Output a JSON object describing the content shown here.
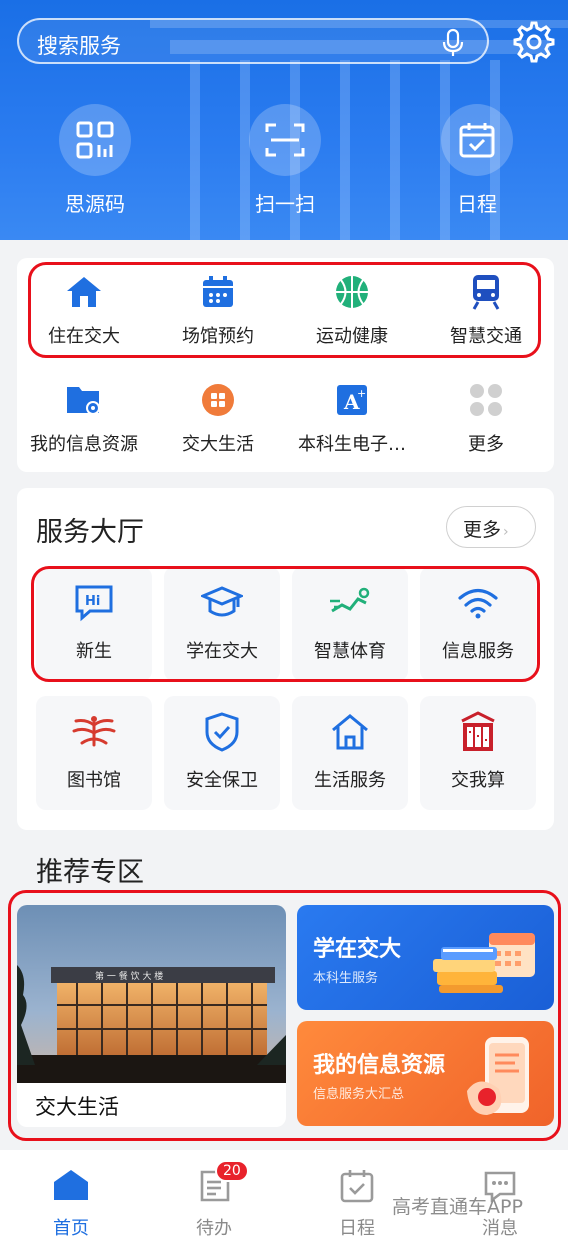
{
  "header": {
    "search_placeholder": "搜索服务",
    "quick_actions": [
      {
        "label": "思源码",
        "icon": "qr-code-icon"
      },
      {
        "label": "扫一扫",
        "icon": "scan-icon"
      },
      {
        "label": "日程",
        "icon": "calendar-check-icon"
      }
    ]
  },
  "shortcuts": [
    {
      "label": "住在交大",
      "icon": "home-icon",
      "color": "#1f6fe0"
    },
    {
      "label": "场馆预约",
      "icon": "calendar-icon",
      "color": "#1f6fe0"
    },
    {
      "label": "运动健康",
      "icon": "basketball-icon",
      "color": "#21b07a"
    },
    {
      "label": "智慧交通",
      "icon": "train-icon",
      "color": "#1f4fbf"
    },
    {
      "label": "我的信息资源",
      "icon": "folder-gear-icon",
      "color": "#1f6fe0"
    },
    {
      "label": "交大生活",
      "icon": "life-icon",
      "color": "#f07b3a"
    },
    {
      "label": "本科生电子…",
      "icon": "font-a-icon",
      "color": "#1f6fe0"
    },
    {
      "label": "更多",
      "icon": "more-dots-icon",
      "color": "#c7c7c7"
    }
  ],
  "service_hall": {
    "title": "服务大厅",
    "more_label": "更多",
    "tiles": [
      {
        "label": "新生",
        "icon": "hi-chat-icon"
      },
      {
        "label": "学在交大",
        "icon": "graduation-cap-icon"
      },
      {
        "label": "智慧体育",
        "icon": "running-icon"
      },
      {
        "label": "信息服务",
        "icon": "wifi-icon"
      },
      {
        "label": "图书馆",
        "icon": "library-icon"
      },
      {
        "label": "安全保卫",
        "icon": "shield-check-icon"
      },
      {
        "label": "生活服务",
        "icon": "house-outline-icon"
      },
      {
        "label": "交我算",
        "icon": "computer-tower-icon"
      }
    ]
  },
  "recommend": {
    "title": "推荐专区",
    "photo_label": "交大生活",
    "building_sign": "第 一 餐 饮 大 楼",
    "banners": [
      {
        "title": "学在交大",
        "subtitle": "本科生服务",
        "color": "#1f6fe0"
      },
      {
        "title": "我的信息资源",
        "subtitle": "信息服务大汇总",
        "color": "#f46b2a"
      }
    ]
  },
  "bottom_nav": [
    {
      "label": "首页",
      "icon": "home-filled-icon",
      "active": true
    },
    {
      "label": "待办",
      "icon": "todo-icon",
      "badge": "20"
    },
    {
      "label": "日程",
      "icon": "calendar-check-icon"
    },
    {
      "label": "消息",
      "icon": "message-icon"
    }
  ],
  "watermark": "高考直通车APP"
}
